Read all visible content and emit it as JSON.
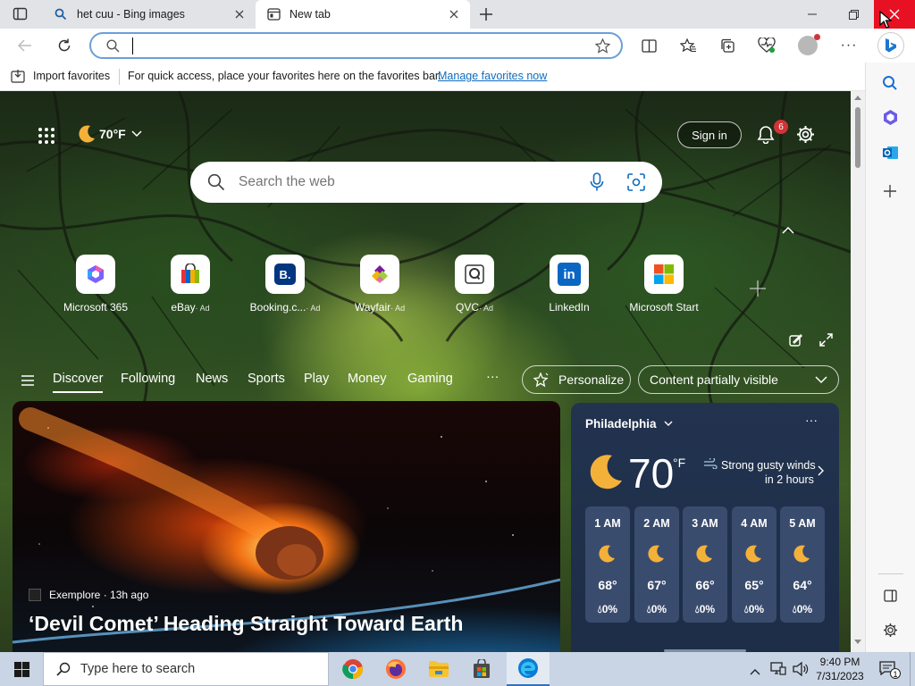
{
  "tabs": [
    {
      "label": "het cuu - Bing images",
      "icon": "search-icon"
    },
    {
      "label": "New tab",
      "icon": "newtab-icon"
    }
  ],
  "address_bar": {
    "value": "",
    "placeholder": ""
  },
  "favorites_bar": {
    "import_label": "Import favorites",
    "message": "For quick access, place your favorites here on the favorites bar.",
    "manage_link": "Manage favorites now"
  },
  "header": {
    "temperature": "70°F",
    "sign_in_label": "Sign in",
    "notification_count": "6"
  },
  "search": {
    "placeholder": "Search the web"
  },
  "quick_links": [
    {
      "label": "Microsoft 365",
      "ad": "",
      "icon": "microsoft365-icon"
    },
    {
      "label": "eBay",
      "ad": "· Ad",
      "icon": "ebay-icon"
    },
    {
      "label": "Booking.c...",
      "ad": "· Ad",
      "icon": "booking-icon"
    },
    {
      "label": "Wayfair",
      "ad": "· Ad",
      "icon": "wayfair-icon"
    },
    {
      "label": "QVC",
      "ad": "· Ad",
      "icon": "qvc-icon"
    },
    {
      "label": "LinkedIn",
      "ad": "",
      "icon": "linkedin-icon"
    },
    {
      "label": "Microsoft Start",
      "ad": "",
      "icon": "microsoft-start-icon"
    }
  ],
  "feed_nav": {
    "items": [
      "Discover",
      "Following",
      "News",
      "Sports",
      "Play",
      "Money",
      "Gaming"
    ],
    "more": "···",
    "personalize_label": "Personalize",
    "visibility_label": "Content partially visible"
  },
  "article": {
    "source": "Exemplore",
    "time": "· 13h ago",
    "title": "‘Devil Comet’ Heading Straight Toward Earth"
  },
  "weather": {
    "city": "Philadelphia",
    "temp": "70",
    "unit": "°F",
    "alert_line1": "Strong gusty winds",
    "alert_line2": "in 2 hours",
    "hours": [
      {
        "time": "1 AM",
        "temp": "68°",
        "precip": "0%"
      },
      {
        "time": "2 AM",
        "temp": "67°",
        "precip": "0%"
      },
      {
        "time": "3 AM",
        "temp": "66°",
        "precip": "0%"
      },
      {
        "time": "4 AM",
        "temp": "65°",
        "precip": "0%"
      },
      {
        "time": "5 AM",
        "temp": "64°",
        "precip": "0%"
      }
    ]
  },
  "taskbar": {
    "search_placeholder": "Type here to search",
    "time": "9:40 PM",
    "date": "7/31/2023",
    "notification_count": "1"
  },
  "colors": {
    "accent": "#0f6cbd",
    "close_red": "#e81123",
    "badge_red": "#d13438"
  }
}
